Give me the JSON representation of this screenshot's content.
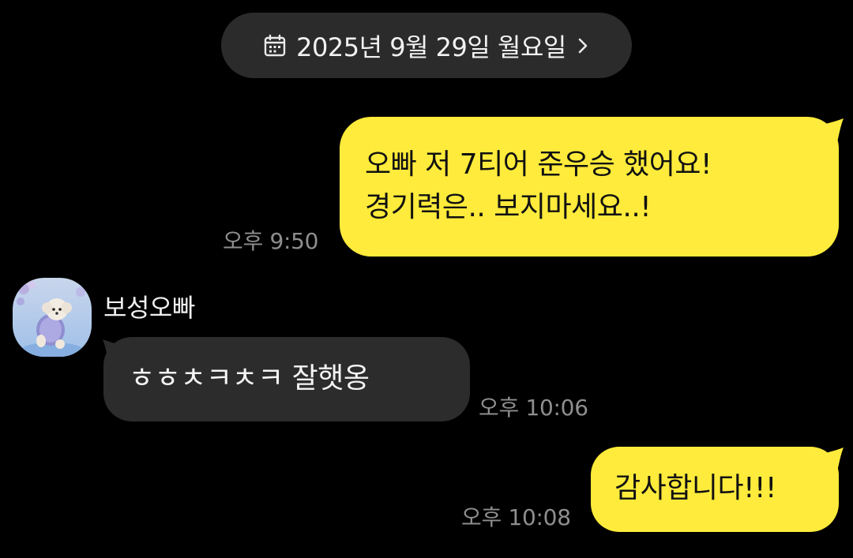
{
  "date_header": {
    "label": "2025년 9월 29일 월요일",
    "icon": "calendar-icon",
    "chevron_icon": "chevron-right-icon"
  },
  "messages": [
    {
      "direction": "outgoing",
      "text": "오빠 저 7티어 준우승 했어요!\n경기력은.. 보지마세요..!",
      "time": "오후 9:50"
    },
    {
      "direction": "incoming",
      "sender": "보성오빠",
      "text": "ㅎㅎㅊㅋㅊㅋ 잘햇옹",
      "time": "오후 10:06"
    },
    {
      "direction": "outgoing",
      "text": "감사합니다!!!",
      "time": "오후 10:08"
    }
  ],
  "colors": {
    "background": "#000000",
    "outgoing_bubble": "#ffeb3b",
    "incoming_bubble": "#2c2c2c",
    "date_pill": "#2b2b2b",
    "time_text": "#8e8e8e"
  }
}
